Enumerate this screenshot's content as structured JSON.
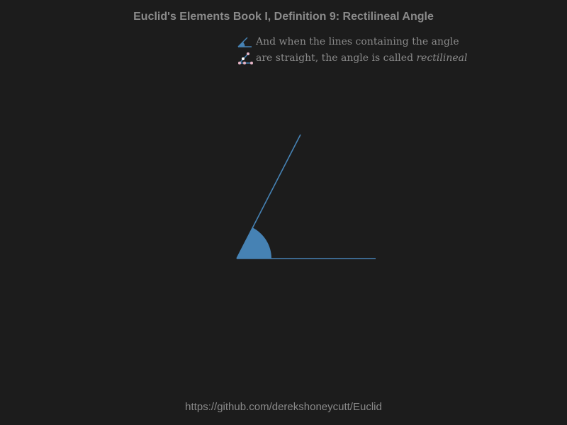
{
  "title": "Euclid's Elements Book I, Definition 9: Rectilineal Angle",
  "legend": {
    "line1": "And when the lines containing the angle",
    "line2_prefix": "are straight, the angle is called ",
    "line2_term": "rectilineal",
    "icon1": "angle-sector-icon",
    "icon2": "straight-lines-icon"
  },
  "footer": "https://github.com/derekshoneycutt/Euclid",
  "colors": {
    "background": "#1c1c1c",
    "text": "#8a8a8a",
    "accent": "#4682b4"
  }
}
